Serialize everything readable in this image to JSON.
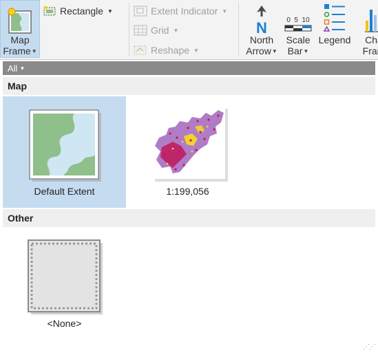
{
  "ribbon": {
    "map_frame": {
      "line1": "Map",
      "line2": "Frame"
    },
    "rectangle": {
      "label": "Rectangle"
    },
    "extent_indicator": {
      "label": "Extent Indicator"
    },
    "grid": {
      "label": "Grid"
    },
    "reshape": {
      "label": "Reshape"
    },
    "north_arrow": {
      "line1": "North",
      "line2": "Arrow"
    },
    "scale_bar": {
      "line1": "Scale",
      "line2": "Bar",
      "ticks": "0  5  10"
    },
    "legend": {
      "line1": "Legend"
    },
    "chart_frame": {
      "line1": "Cha",
      "line2": "Fram"
    }
  },
  "gallery": {
    "filter": "All",
    "sections": {
      "map": "Map",
      "other": "Other"
    },
    "tiles": {
      "default_extent": "Default Extent",
      "scale_199056": "1:199,056",
      "none": "<None>"
    }
  },
  "colors": {
    "selection": "#c5dcf0",
    "ribbon_bg": "#f3f3f3",
    "map_green": "#8fbf8a",
    "map_water": "#cfe6f3",
    "map_purple": "#b07cc6",
    "map_red": "#c0185a",
    "map_yellow": "#f2d22e"
  }
}
